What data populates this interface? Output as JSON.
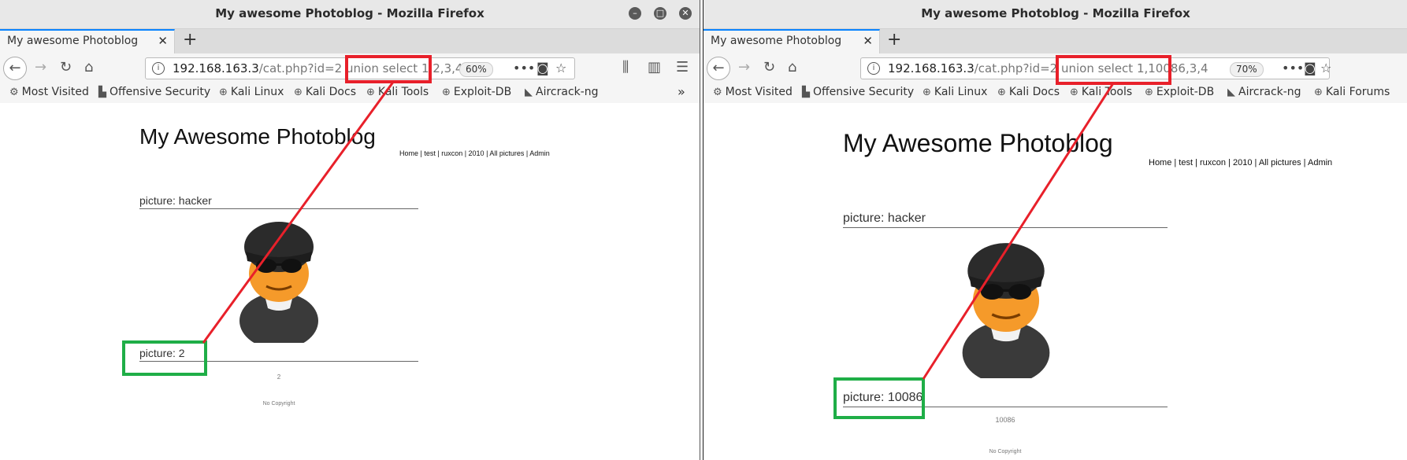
{
  "left": {
    "window_title": "My awesome Photoblog - Mozilla Firefox",
    "tab_label": "My awesome Photoblog",
    "url_host": "192.168.163.3",
    "url_path_before": "/cat.php?id=2 union ",
    "url_injection": "select 1,2,3,4",
    "zoom": "60%",
    "bookmarks": [
      "Most Visited",
      "Offensive Security",
      "Kali Linux",
      "Kali Docs",
      "Kali Tools",
      "Exploit-DB",
      "Aircrack-ng"
    ],
    "overflow": "»",
    "site_title": "My Awesome Photoblog",
    "site_nav": "Home | test | ruxcon | 2010 | All pictures | Admin",
    "pic1_heading": "picture: hacker",
    "pic2_heading": "picture: 2",
    "pic2_caption": "2",
    "footer": "No Copyright"
  },
  "right": {
    "window_title": "My awesome Photoblog - Mozilla Firefox",
    "tab_label": "My awesome Photoblog",
    "url_host": "192.168.163.3",
    "url_path_before": "/cat.php?id=2 union ",
    "url_injection": "select 1,10086,3,4",
    "zoom": "70%",
    "bookmarks": [
      "Most Visited",
      "Offensive Security",
      "Kali Linux",
      "Kali Docs",
      "Kali Tools",
      "Exploit-DB",
      "Aircrack-ng",
      "Kali Forums"
    ],
    "site_title": "My Awesome Photoblog",
    "site_nav": "Home | test | ruxcon | 2010 | All pictures | Admin",
    "pic1_heading": "picture: hacker",
    "pic2_heading": "picture: 10086",
    "pic2_caption": "10086",
    "footer": "No Copyright"
  },
  "colors": {
    "highlight_red": "#e8202a",
    "highlight_green": "#1fae47",
    "accent_tab": "#0a84ff"
  }
}
